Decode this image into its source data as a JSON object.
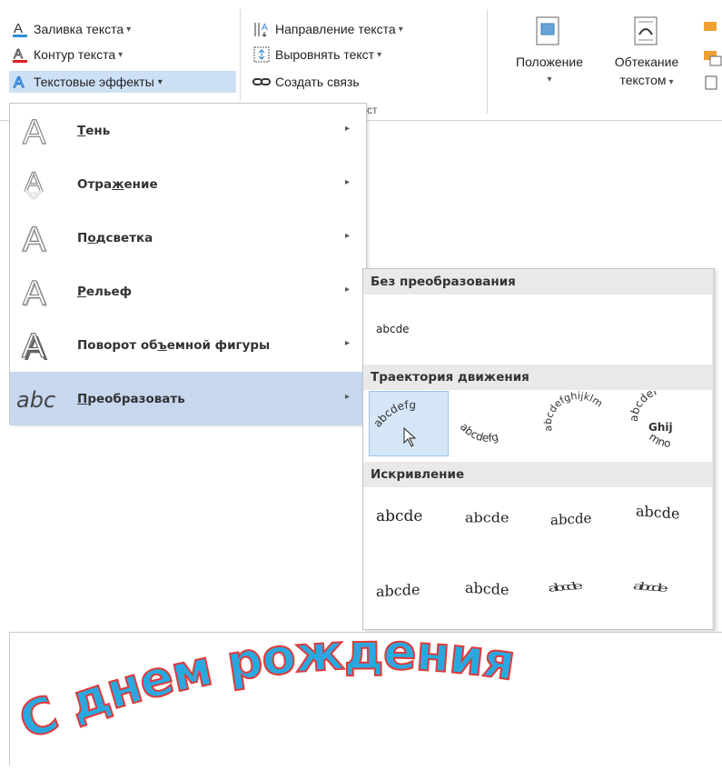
{
  "ribbon": {
    "fill_text": "Заливка текста",
    "outline_text": "Контур текста",
    "text_effects": "Текстовые эффекты",
    "text_direction": "Направление текста",
    "align_text": "Выровнять текст",
    "create_link": "Создать связь",
    "group_label_partial": "ст",
    "position_label": "Положение",
    "wrap_label_1": "Обтекание",
    "wrap_label_2": "текстом",
    "dropdown_glyph": "▾",
    "fill_color": "#2e8fd6",
    "outline_color": "#e02020"
  },
  "menu": {
    "items": [
      {
        "label": "Тень",
        "underline_index": 0
      },
      {
        "label": "Отражение",
        "underline_index": 4
      },
      {
        "label": "Подсветка",
        "underline_index": 1
      },
      {
        "label": "Рельеф",
        "underline_index": 0
      },
      {
        "label": "Поворот объемной фигуры",
        "underline_index": 10
      },
      {
        "label": "Преобразовать",
        "underline_index": 0
      }
    ],
    "arrow": "▸",
    "selected_index": 5
  },
  "submenu": {
    "section1": "Без преобразования",
    "plain_sample": "abcde",
    "section2": "Траектория движения",
    "path_sample_1": "abcdefg",
    "path_sample_2": "abcdefg",
    "path_sample_3": "abcdefghijklm",
    "path_sample_4": "abcdef",
    "path_sample_4_inner": "Ghij",
    "path_sample_4_bottom": "mno",
    "section3": "Искривление",
    "warp_samples": [
      "abcde",
      "abcde",
      "abcde",
      "abcde",
      "abcde",
      "abcde",
      "abcde",
      "abcde"
    ],
    "hover_color": "#d5e6f7"
  },
  "document": {
    "wordart": "С днем рождения",
    "wordart_fill": "#29a8e0",
    "wordart_outline": "#e03a3a"
  }
}
